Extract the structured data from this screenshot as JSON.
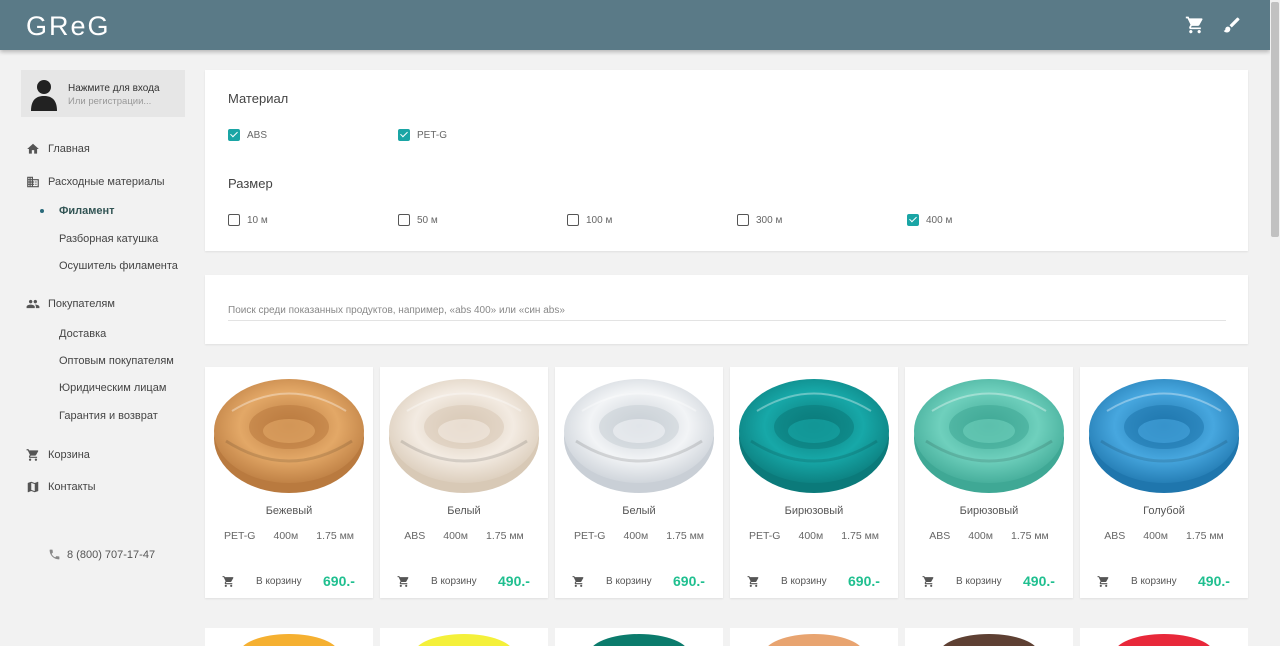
{
  "header": {
    "logo": "GReG",
    "cart_icon": "cart-icon",
    "brush_icon": "brush-icon",
    "bg": "#5a7a87"
  },
  "user": {
    "login_text": "Нажмите для входа",
    "register_text": "Или регистрации..."
  },
  "nav": {
    "home": "Главная",
    "consumables": "Расходные материалы",
    "filament": "Филамент",
    "spool": "Разборная катушка",
    "dryer": "Осушитель филамента",
    "customers": "Покупателям",
    "delivery": "Доставка",
    "wholesale": "Оптовым покупателям",
    "legal": "Юридическим лицам",
    "warranty": "Гарантия и возврат",
    "cart": "Корзина",
    "contacts": "Контакты",
    "phone": "8 (800) 707-17-47"
  },
  "filters": {
    "material_title": "Материал",
    "materials": [
      {
        "label": "ABS",
        "checked": true
      },
      {
        "label": "PET-G",
        "checked": true
      }
    ],
    "size_title": "Размер",
    "sizes": [
      {
        "label": "10 м",
        "checked": false
      },
      {
        "label": "50 м",
        "checked": false
      },
      {
        "label": "100 м",
        "checked": false
      },
      {
        "label": "300 м",
        "checked": false
      },
      {
        "label": "400 м",
        "checked": true
      }
    ]
  },
  "search": {
    "placeholder": "Поиск среди показанных продуктов, например, «abs 400» или «син abs»"
  },
  "to_cart_label": "В корзину",
  "products": [
    {
      "name": "Бежевый",
      "material": "PET-G",
      "length": "400м",
      "diameter": "1.75 мм",
      "price": "690.-",
      "color": "#e3a867",
      "dark": "#b97a3f"
    },
    {
      "name": "Белый",
      "material": "ABS",
      "length": "400м",
      "diameter": "1.75 мм",
      "price": "490.-",
      "color": "#f3ebe2",
      "dark": "#d8c9b6"
    },
    {
      "name": "Белый",
      "material": "PET-G",
      "length": "400м",
      "diameter": "1.75 мм",
      "price": "690.-",
      "color": "#f2f4f6",
      "dark": "#c9cfd6"
    },
    {
      "name": "Бирюзовый",
      "material": "PET-G",
      "length": "400м",
      "diameter": "1.75 мм",
      "price": "690.-",
      "color": "#17a8a8",
      "dark": "#0b7a7a"
    },
    {
      "name": "Бирюзовый",
      "material": "ABS",
      "length": "400м",
      "diameter": "1.75 мм",
      "price": "490.-",
      "color": "#6fd0bd",
      "dark": "#3fa895"
    },
    {
      "name": "Голубой",
      "material": "ABS",
      "length": "400м",
      "diameter": "1.75 мм",
      "price": "490.-",
      "color": "#47a7df",
      "dark": "#1f76ad"
    }
  ],
  "next_row_colors": [
    "#f5b031",
    "#f4f03a",
    "#0b7b6c",
    "#e8a470",
    "#5e4033",
    "#e8283a"
  ]
}
